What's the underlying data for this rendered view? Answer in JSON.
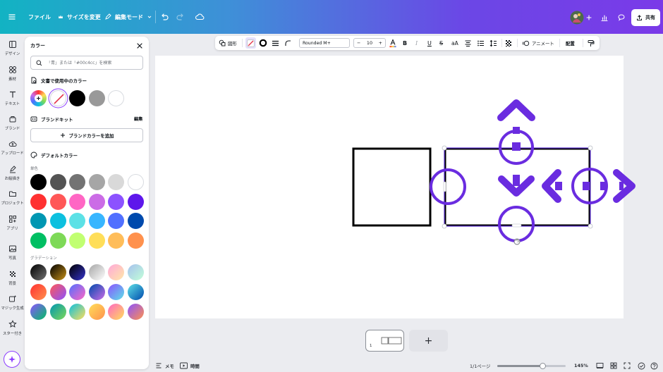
{
  "topbar": {
    "menu_icon": "hamburger-icon",
    "file_label": "ファイル",
    "resize_label": "サイズを変更",
    "edit_mode_label": "編集モード",
    "share_label": "共有",
    "gradient_colors": [
      "#12b3c3",
      "#6b47e6",
      "#7a3ae8"
    ]
  },
  "rail": {
    "items": [
      {
        "label": "デザイン",
        "icon": "layout-icon"
      },
      {
        "label": "素材",
        "icon": "elements-icon"
      },
      {
        "label": "テキスト",
        "icon": "text-icon"
      },
      {
        "label": "ブランド",
        "icon": "brand-icon"
      },
      {
        "label": "アップロード",
        "icon": "upload-icon"
      },
      {
        "label": "お絵描き",
        "icon": "draw-icon"
      },
      {
        "label": "プロジェクト",
        "icon": "folder-icon"
      },
      {
        "label": "アプリ",
        "icon": "apps-icon"
      },
      {
        "label": "写真",
        "icon": "photo-icon"
      },
      {
        "label": "背景",
        "icon": "background-icon"
      },
      {
        "label": "マジック生成",
        "icon": "magic-media-icon"
      },
      {
        "label": "スター付き",
        "icon": "star-icon"
      }
    ]
  },
  "color_panel": {
    "title": "カラー",
    "search_placeholder": "「青」または「#00c4cc」を検索",
    "doc_colors_title": "文書で使用中のカラー",
    "doc_colors": [
      "#000000",
      "#999999",
      "#ffffff"
    ],
    "brand_kit_title": "ブランドキット",
    "brand_kit_edit": "編集",
    "add_brand_color": "ブランドカラーを追加",
    "default_colors_title": "デフォルトカラー",
    "solid_label": "単色",
    "solid_colors": [
      "#000000",
      "#545454",
      "#737373",
      "#a6a6a6",
      "#d9d9d9",
      "#ffffff",
      "#ff3131",
      "#ff5757",
      "#ff66c4",
      "#cb6ce6",
      "#8c52ff",
      "#5e17eb",
      "#0097b2",
      "#0cc0df",
      "#5ce1e6",
      "#38b6ff",
      "#5170ff",
      "#004aad",
      "#00bf63",
      "#7ed957",
      "#c1ff72",
      "#ffde59",
      "#ffbd59",
      "#ff914d"
    ],
    "gradient_label": "グラデーション",
    "gradients": [
      [
        "#000000",
        "#737373"
      ],
      [
        "#000000",
        "#c89116"
      ],
      [
        "#000000",
        "#3533cd"
      ],
      [
        "#a6a6a6",
        "#ffffff"
      ],
      [
        "#ffa8d9",
        "#ffe8a8"
      ],
      [
        "#a6c1ee",
        "#c2ffd8"
      ],
      [
        "#ff3131",
        "#ff914d"
      ],
      [
        "#ff5757",
        "#8c52ff"
      ],
      [
        "#5170ff",
        "#ff66c4"
      ],
      [
        "#004aad",
        "#cb6ce6"
      ],
      [
        "#8c52ff",
        "#5ce1e6"
      ],
      [
        "#5de0e6",
        "#004aad"
      ],
      [
        "#8c52ff",
        "#00bf63"
      ],
      [
        "#0097b2",
        "#7ed957"
      ],
      [
        "#0cc0df",
        "#ffde59"
      ],
      [
        "#ffde59",
        "#ff914d"
      ],
      [
        "#ff66c4",
        "#ffde59"
      ],
      [
        "#8c52ff",
        "#ff914d"
      ]
    ]
  },
  "context_toolbar": {
    "shape_label": "図形",
    "font_name": "Rounded M+",
    "font_size": "10",
    "animate_label": "アニメート",
    "position_label": "配置"
  },
  "pages": {
    "thumb_number": "1",
    "add_symbol": "+"
  },
  "footer": {
    "notes_label": "メモ",
    "timer_label": "時間",
    "page_indicator": "1/1ページ",
    "zoom_label": "145%",
    "zoom_fraction": 0.66
  },
  "colors": {
    "accent": "#8b3dff",
    "selection": "#5b2fd1",
    "shape_stroke": "#000000"
  }
}
